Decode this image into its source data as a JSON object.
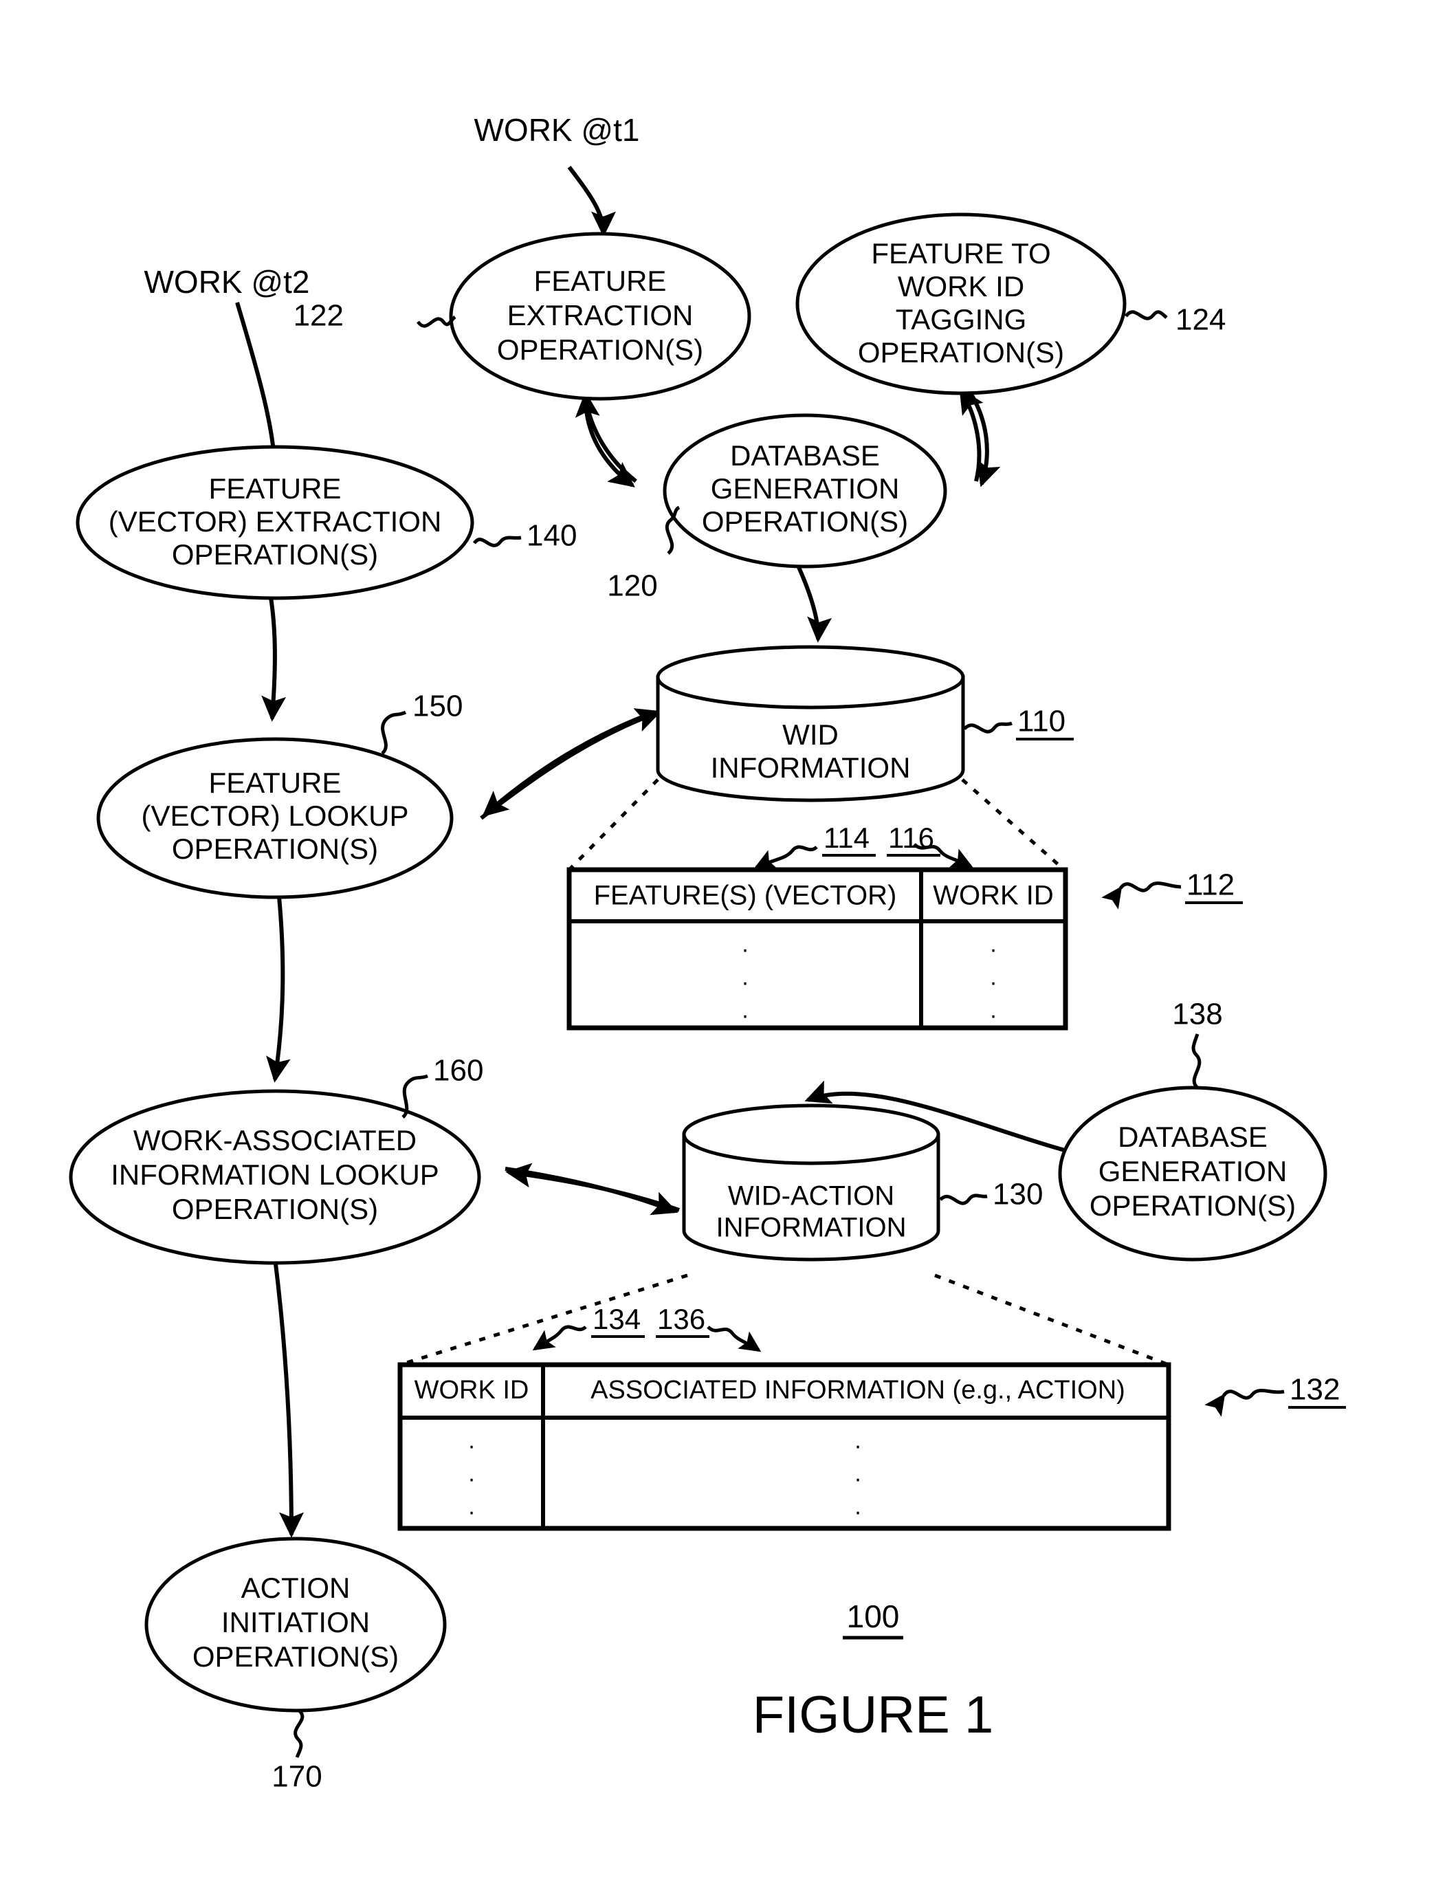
{
  "figure": {
    "caption": "FIGURE 1",
    "system_ref": "100"
  },
  "inputs": [
    {
      "id": "work_t1",
      "label": "WORK @t1"
    },
    {
      "id": "work_t2",
      "label": "WORK @t2"
    }
  ],
  "nodes": {
    "feature_extraction": {
      "lines": [
        "FEATURE",
        "EXTRACTION",
        "OPERATION(S)"
      ],
      "ref": "122"
    },
    "feature_to_work_id_tagging": {
      "lines": [
        "FEATURE TO",
        "WORK ID",
        "TAGGING",
        "OPERATION(S)"
      ],
      "ref": "124"
    },
    "database_generation_top": {
      "lines": [
        "DATABASE",
        "GENERATION",
        "OPERATION(S)"
      ],
      "ref": "120"
    },
    "feature_vector_extraction": {
      "lines": [
        "FEATURE",
        "(VECTOR) EXTRACTION",
        "OPERATION(S)"
      ],
      "ref": "140"
    },
    "feature_vector_lookup": {
      "lines": [
        "FEATURE",
        "(VECTOR) LOOKUP",
        "OPERATION(S)"
      ],
      "ref": "150"
    },
    "work_associated_info_lookup": {
      "lines": [
        "WORK-ASSOCIATED",
        "INFORMATION LOOKUP",
        "OPERATION(S)"
      ],
      "ref": "160"
    },
    "action_initiation": {
      "lines": [
        "ACTION",
        "INITIATION",
        "OPERATION(S)"
      ],
      "ref": "170"
    },
    "database_generation_bottom": {
      "lines": [
        "DATABASE",
        "GENERATION",
        "OPERATION(S)"
      ],
      "ref": "138"
    },
    "wid_information_store": {
      "lines": [
        "WID",
        "INFORMATION"
      ],
      "ref": "110"
    },
    "wid_action_information_store": {
      "lines": [
        "WID-ACTION",
        "INFORMATION"
      ],
      "ref": "130"
    }
  },
  "tables": {
    "wid_table": {
      "ref": "112",
      "columns": [
        {
          "header": "FEATURE(S) (VECTOR)",
          "ref": "114"
        },
        {
          "header": "WORK ID",
          "ref": "116"
        }
      ],
      "row_placeholder": "·"
    },
    "wid_action_table": {
      "ref": "132",
      "columns": [
        {
          "header": "WORK ID",
          "ref": "134"
        },
        {
          "header": "ASSOCIATED INFORMATION (e.g., ACTION)",
          "ref": "136"
        }
      ],
      "row_placeholder": "·"
    }
  }
}
